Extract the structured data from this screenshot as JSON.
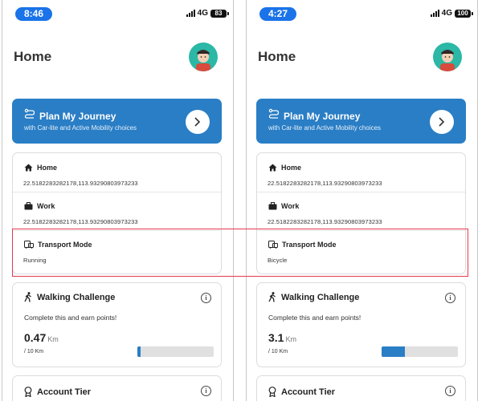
{
  "colors": {
    "accent": "#2a7ec5",
    "time_pill": "#1a73e8",
    "highlight": "#e53950",
    "avatar_bg": "#2bb8a6"
  },
  "phones": [
    {
      "status": {
        "time": "8:46",
        "network": "4G",
        "battery": "83"
      },
      "header": {
        "title": "Home",
        "avatar_icon": "user-avatar-icon"
      },
      "plan": {
        "title": "Plan My Journey",
        "subtitle": "with Car-lite and Active Mobility choices",
        "icon": "route-icon",
        "action_icon": "chevron-right-icon"
      },
      "locations": [
        {
          "label": "Home",
          "value": "22.5182283282178,113.93290803973233",
          "icon": "home-icon"
        },
        {
          "label": "Work",
          "value": "22.5182283282178,113.93290803973233",
          "icon": "briefcase-icon"
        },
        {
          "label": "Transport Mode",
          "value": "Running",
          "icon": "transport-icon"
        }
      ],
      "challenge": {
        "title": "Walking Challenge",
        "subtitle": "Complete this and earn points!",
        "value": "0.47",
        "unit": "Km",
        "goal": "/ 10 Km",
        "progress": 0.047,
        "icon": "walking-icon",
        "info_icon": "info-icon"
      },
      "tier": {
        "title": "Account Tier",
        "icon": "award-icon",
        "info_icon": "info-icon"
      }
    },
    {
      "status": {
        "time": "4:27",
        "network": "4G",
        "battery": "100"
      },
      "header": {
        "title": "Home",
        "avatar_icon": "user-avatar-icon"
      },
      "plan": {
        "title": "Plan My Journey",
        "subtitle": "with Car-lite and Active Mobility choices",
        "icon": "route-icon",
        "action_icon": "chevron-right-icon"
      },
      "locations": [
        {
          "label": "Home",
          "value": "22.5182283282178,113.93290803973233",
          "icon": "home-icon"
        },
        {
          "label": "Work",
          "value": "22.5182283282178,113.93290803973233",
          "icon": "briefcase-icon"
        },
        {
          "label": "Transport Mode",
          "value": "Bicycle",
          "icon": "transport-icon"
        }
      ],
      "challenge": {
        "title": "Walking Challenge",
        "subtitle": "Complete this and earn points!",
        "value": "3.1",
        "unit": "Km",
        "goal": "/ 10 Km",
        "progress": 0.31,
        "icon": "walking-icon",
        "info_icon": "info-icon"
      },
      "tier": {
        "title": "Account Tier",
        "icon": "award-icon",
        "info_icon": "info-icon"
      }
    }
  ]
}
